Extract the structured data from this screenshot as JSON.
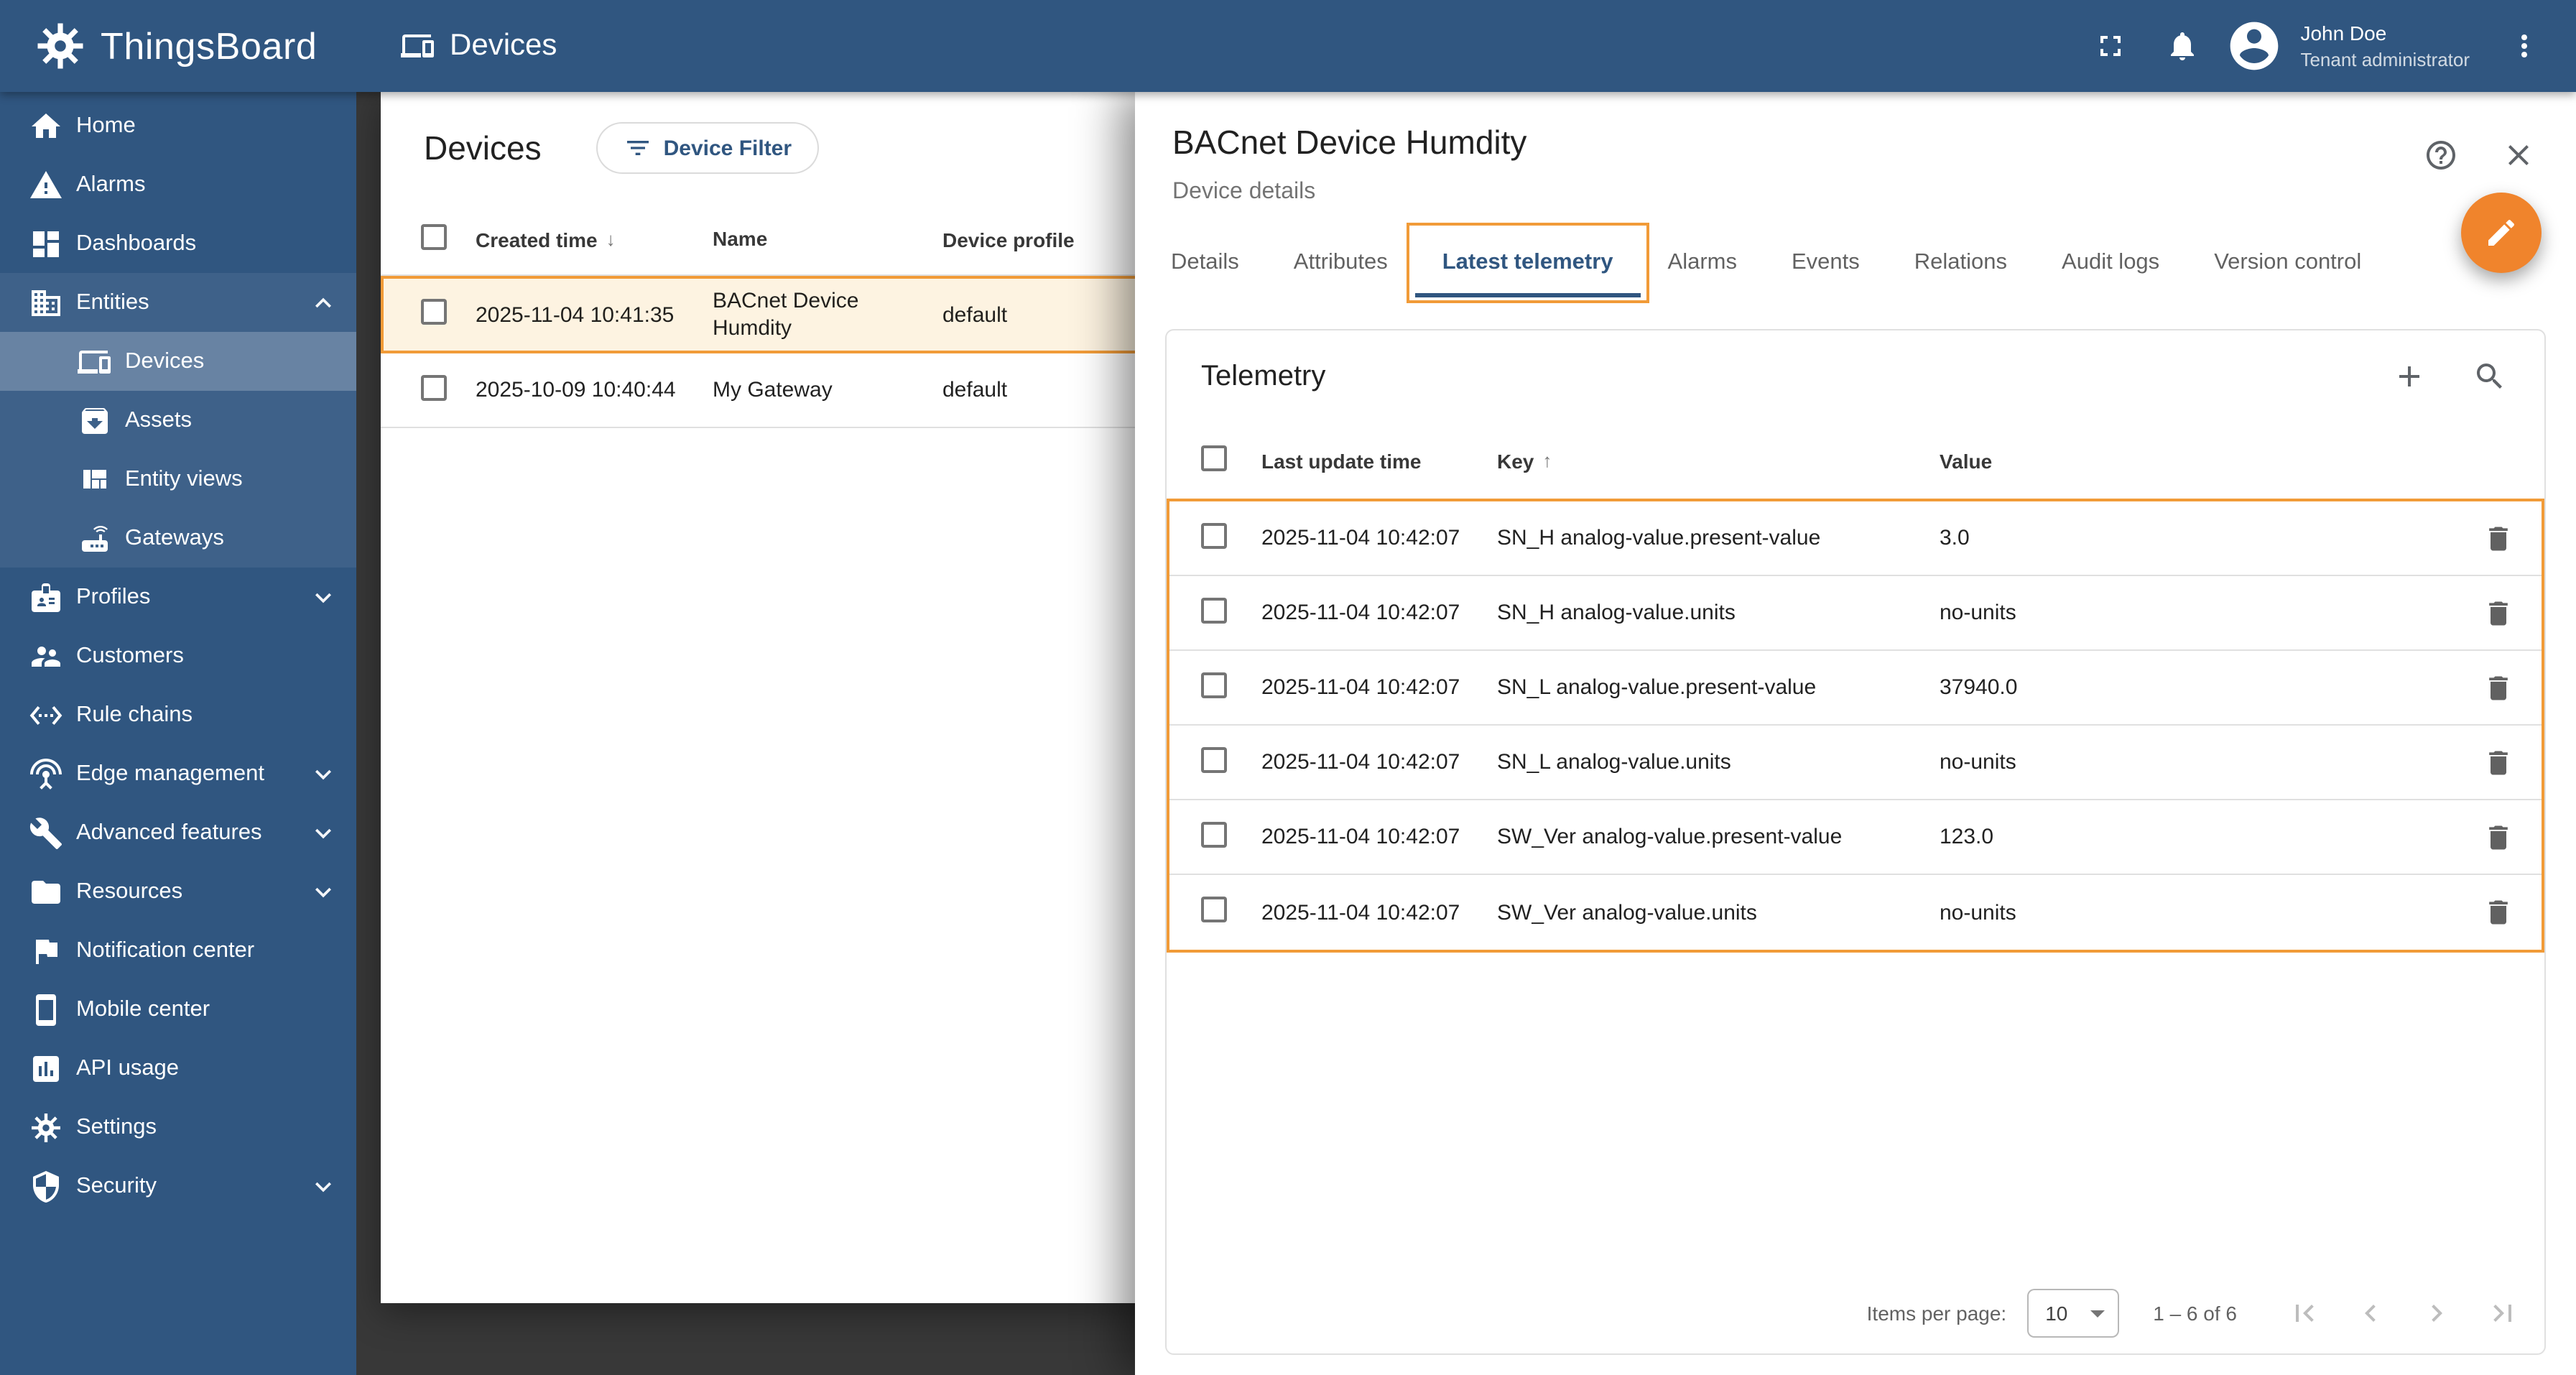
{
  "colors": {
    "primary": "#305680",
    "annotation": "#F19B38",
    "fab": "#F0842C",
    "backdrop": "#383838"
  },
  "header": {
    "app_title": "ThingsBoard",
    "page_title": "Devices",
    "user": {
      "name": "John Doe",
      "role": "Tenant administrator"
    }
  },
  "sidebar": {
    "items": [
      {
        "label": "Home",
        "icon": "home-icon"
      },
      {
        "label": "Alarms",
        "icon": "alarms-icon"
      },
      {
        "label": "Dashboards",
        "icon": "dashboards-icon"
      },
      {
        "label": "Entities",
        "icon": "entities-icon",
        "expanded": true,
        "children": [
          {
            "label": "Devices",
            "icon": "devices-icon",
            "selected": true
          },
          {
            "label": "Assets",
            "icon": "assets-icon"
          },
          {
            "label": "Entity views",
            "icon": "entity-views-icon"
          },
          {
            "label": "Gateways",
            "icon": "gateways-icon"
          }
        ]
      },
      {
        "label": "Profiles",
        "icon": "profiles-icon",
        "collapsible": true
      },
      {
        "label": "Customers",
        "icon": "customers-icon"
      },
      {
        "label": "Rule chains",
        "icon": "rule-chains-icon"
      },
      {
        "label": "Edge management",
        "icon": "edge-management-icon",
        "collapsible": true
      },
      {
        "label": "Advanced features",
        "icon": "advanced-features-icon",
        "collapsible": true
      },
      {
        "label": "Resources",
        "icon": "resources-icon",
        "collapsible": true
      },
      {
        "label": "Notification center",
        "icon": "notification-center-icon"
      },
      {
        "label": "Mobile center",
        "icon": "mobile-center-icon"
      },
      {
        "label": "API usage",
        "icon": "api-usage-icon"
      },
      {
        "label": "Settings",
        "icon": "settings-icon"
      },
      {
        "label": "Security",
        "icon": "security-icon",
        "collapsible": true
      }
    ]
  },
  "devices_panel": {
    "title": "Devices",
    "filter_button_label": "Device Filter",
    "columns": {
      "created": "Created time",
      "name": "Name",
      "profile": "Device profile"
    },
    "sort": {
      "column": "Created time",
      "direction": "desc"
    },
    "rows": [
      {
        "created": "2025-11-04 10:41:35",
        "name": "BACnet Device Humdity",
        "profile": "default",
        "highlighted": true
      },
      {
        "created": "2025-10-09 10:40:44",
        "name": "My Gateway",
        "profile": "default",
        "highlighted": false
      }
    ]
  },
  "details_panel": {
    "title": "BACnet Device Humdity",
    "subtitle": "Device details",
    "tabs": [
      "Details",
      "Attributes",
      "Latest telemetry",
      "Alarms",
      "Events",
      "Relations",
      "Audit logs",
      "Version control"
    ],
    "active_tab": "Latest telemetry",
    "telemetry": {
      "title": "Telemetry",
      "columns": {
        "time": "Last update time",
        "key": "Key",
        "value": "Value"
      },
      "sort": {
        "column": "Key",
        "direction": "asc"
      },
      "rows": [
        {
          "time": "2025-11-04 10:42:07",
          "key": "SN_H analog-value.present-value",
          "value": "3.0"
        },
        {
          "time": "2025-11-04 10:42:07",
          "key": "SN_H analog-value.units",
          "value": "no-units"
        },
        {
          "time": "2025-11-04 10:42:07",
          "key": "SN_L analog-value.present-value",
          "value": "37940.0"
        },
        {
          "time": "2025-11-04 10:42:07",
          "key": "SN_L analog-value.units",
          "value": "no-units"
        },
        {
          "time": "2025-11-04 10:42:07",
          "key": "SW_Ver analog-value.present-value",
          "value": "123.0"
        },
        {
          "time": "2025-11-04 10:42:07",
          "key": "SW_Ver analog-value.units",
          "value": "no-units"
        }
      ],
      "pagination": {
        "items_per_page_label": "Items per page:",
        "items_per_page": "10",
        "range": "1 – 6 of 6"
      }
    }
  }
}
